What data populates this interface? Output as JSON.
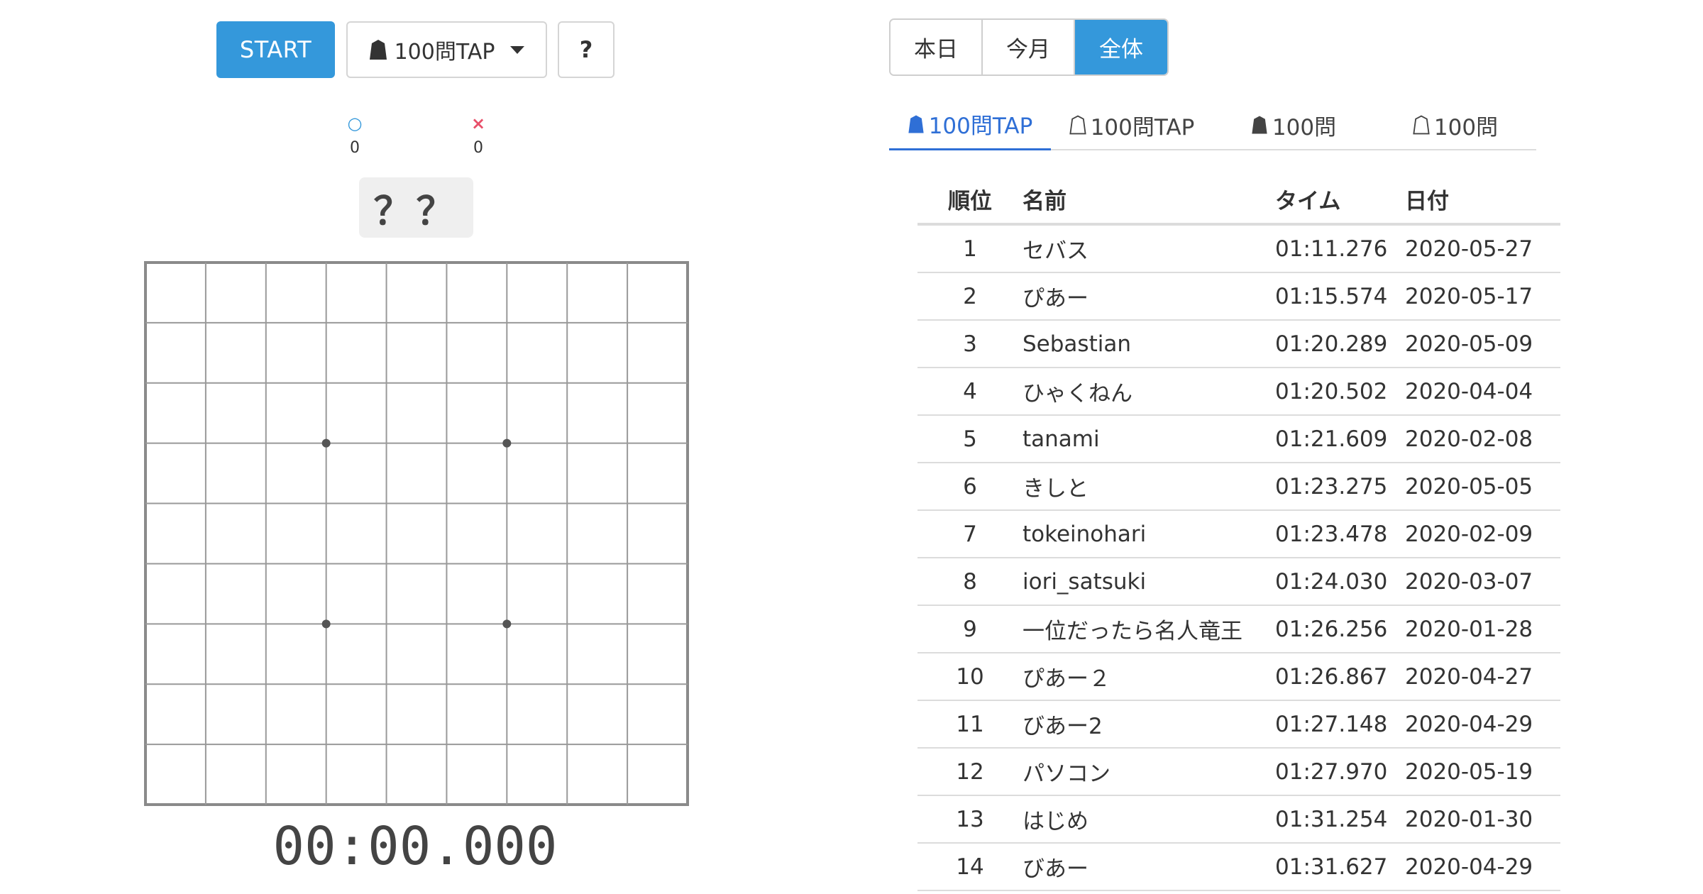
{
  "controls": {
    "start_label": "START",
    "mode_label": "100問TAP",
    "help_label": "?"
  },
  "score": {
    "correct_mark": "○",
    "correct_count": "0",
    "wrong_mark": "×",
    "wrong_count": "0"
  },
  "question": "？？",
  "board": {
    "size": 9,
    "star_points": [
      [
        3,
        3
      ],
      [
        3,
        6
      ],
      [
        6,
        3
      ],
      [
        6,
        6
      ]
    ]
  },
  "timer": "00:00.000",
  "period_tabs": [
    "本日",
    "今月",
    "全体"
  ],
  "period_active": "全体",
  "mode_tabs": [
    "100問TAP",
    "100問TAP",
    "100問",
    "100問"
  ],
  "ranking": {
    "headers": {
      "rank": "順位",
      "name": "名前",
      "time": "タイム",
      "date": "日付"
    },
    "rows": [
      {
        "rank": "1",
        "name": "セバス",
        "time": "01:11.276",
        "date": "2020-05-27"
      },
      {
        "rank": "2",
        "name": "ぴあー",
        "time": "01:15.574",
        "date": "2020-05-17"
      },
      {
        "rank": "3",
        "name": "Sebastian",
        "time": "01:20.289",
        "date": "2020-05-09"
      },
      {
        "rank": "4",
        "name": "ひゃくねん",
        "time": "01:20.502",
        "date": "2020-04-04"
      },
      {
        "rank": "5",
        "name": "tanami",
        "time": "01:21.609",
        "date": "2020-02-08"
      },
      {
        "rank": "6",
        "name": "きしと",
        "time": "01:23.275",
        "date": "2020-05-05"
      },
      {
        "rank": "7",
        "name": "tokeinohari",
        "time": "01:23.478",
        "date": "2020-02-09"
      },
      {
        "rank": "8",
        "name": "iori_satsuki",
        "time": "01:24.030",
        "date": "2020-03-07"
      },
      {
        "rank": "9",
        "name": "一位だったら名人竜王",
        "time": "01:26.256",
        "date": "2020-01-28"
      },
      {
        "rank": "10",
        "name": "ぴあー２",
        "time": "01:26.867",
        "date": "2020-04-27"
      },
      {
        "rank": "11",
        "name": "びあー2",
        "time": "01:27.148",
        "date": "2020-04-29"
      },
      {
        "rank": "12",
        "name": "パソコン",
        "time": "01:27.970",
        "date": "2020-05-19"
      },
      {
        "rank": "13",
        "name": "はじめ",
        "time": "01:31.254",
        "date": "2020-01-30"
      },
      {
        "rank": "14",
        "name": "びあー",
        "time": "01:31.627",
        "date": "2020-04-29"
      }
    ]
  },
  "colors": {
    "accent": "#3498db",
    "tab_active": "#2f6fd6",
    "correct": "#3498db",
    "wrong": "#e8506a",
    "grid_line": "#999999",
    "board_border": "#8a8a8a"
  },
  "icons": {
    "black_piece": "shogi-piece-filled-icon",
    "white_piece": "shogi-piece-outline-icon",
    "dropdown": "caret-down-icon"
  }
}
